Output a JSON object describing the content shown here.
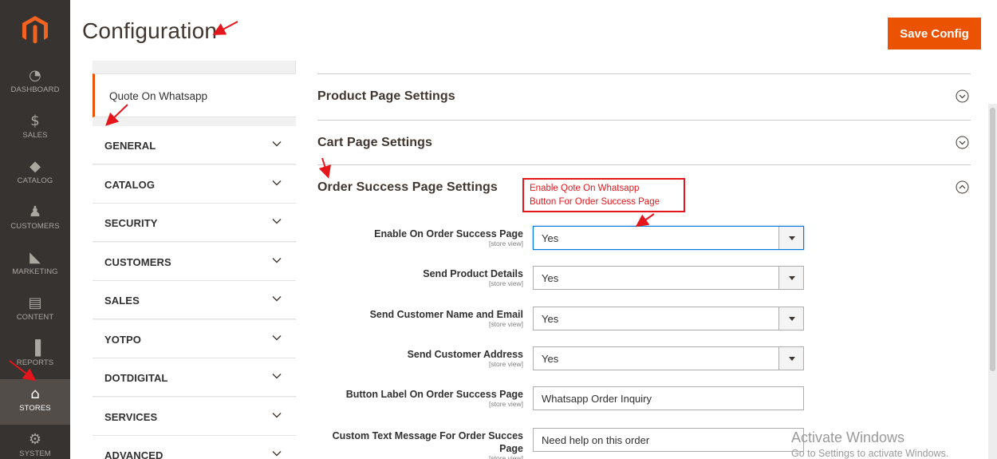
{
  "nav": {
    "items": [
      {
        "label": "DASHBOARD",
        "icon": "dashboard-icon",
        "glyph": "◔"
      },
      {
        "label": "SALES",
        "icon": "dollar-icon",
        "glyph": "$"
      },
      {
        "label": "CATALOG",
        "icon": "catalog-box-icon",
        "glyph": "◆"
      },
      {
        "label": "CUSTOMERS",
        "icon": "customers-person-icon",
        "glyph": "♟"
      },
      {
        "label": "MARKETING",
        "icon": "megaphone-icon",
        "glyph": "◣"
      },
      {
        "label": "CONTENT",
        "icon": "content-layout-icon",
        "glyph": "▤"
      },
      {
        "label": "REPORTS",
        "icon": "bar-chart-icon",
        "glyph": "▐"
      },
      {
        "label": "STORES",
        "icon": "store-icon",
        "glyph": "⌂"
      },
      {
        "label": "SYSTEM",
        "icon": "gear-icon",
        "glyph": "⚙"
      }
    ],
    "active": "STORES"
  },
  "header": {
    "title": "Configuration",
    "save_label": "Save Config"
  },
  "colors": {
    "accent": "#eb5202",
    "nav_bg": "#373330",
    "annotation": "#e4161b"
  },
  "tabs": {
    "active_item": "Quote On Whatsapp",
    "groups": [
      "GENERAL",
      "CATALOG",
      "SECURITY",
      "CUSTOMERS",
      "SALES",
      "YOTPO",
      "DOTDIGITAL",
      "SERVICES",
      "ADVANCED"
    ]
  },
  "sections": [
    {
      "title": "Product Page Settings",
      "state": "collapsed"
    },
    {
      "title": "Cart Page Settings",
      "state": "collapsed"
    },
    {
      "title": "Order Success Page Settings",
      "state": "expanded"
    }
  ],
  "fields": [
    {
      "label": "Enable On Order Success Page",
      "scope": "[store view]",
      "type": "select",
      "value": "Yes"
    },
    {
      "label": "Send Product Details",
      "scope": "[store view]",
      "type": "select",
      "value": "Yes"
    },
    {
      "label": "Send Customer Name and Email",
      "scope": "[store view]",
      "type": "select",
      "value": "Yes"
    },
    {
      "label": "Send Customer Address",
      "scope": "[store view]",
      "type": "select",
      "value": "Yes"
    },
    {
      "label": "Button Label On Order Success Page",
      "scope": "[store view]",
      "type": "text",
      "value": "Whatsapp Order Inquiry"
    },
    {
      "label": "Custom Text Message For Order Succes",
      "label2": "Page",
      "scope": "[store view]",
      "type": "text",
      "value": "Need help on this order"
    }
  ],
  "annotation": {
    "line1": "Enable Qote On Whatsapp",
    "line2": "Button For Order Success Page"
  },
  "watermark": {
    "line1": "Activate Windows",
    "line2": "Go to Settings to activate Windows."
  }
}
